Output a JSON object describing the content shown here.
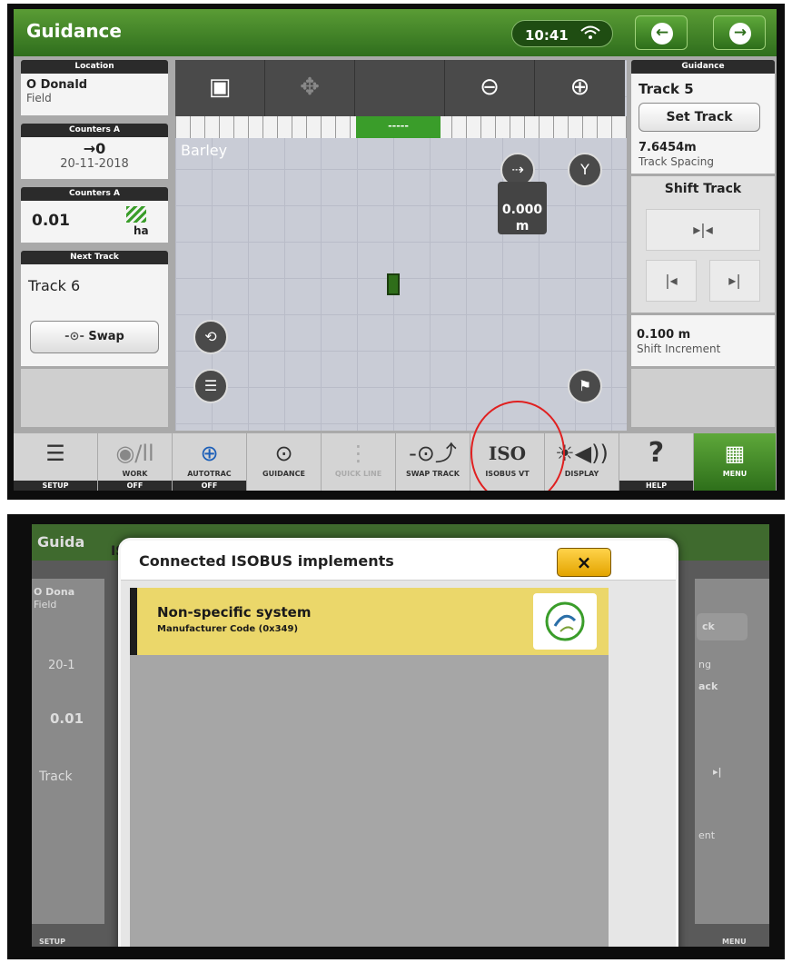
{
  "screen1": {
    "title": "Guidance",
    "clock": "10:41",
    "left_panel": {
      "location_header": "Location",
      "location_name": "O Donald",
      "location_sub": "Field",
      "counters_a_header_1": "Counters A",
      "counter_value": "→0",
      "counter_date": "20-11-2018",
      "counters_a_header_2": "Counters A",
      "area_value": "0.01",
      "area_unit": "ha",
      "next_track_header": "Next Track",
      "next_track_value": "Track 6",
      "swap_label": "Swap"
    },
    "map": {
      "crop_label": "Barley",
      "lightbar_center": "-----",
      "offset_value": "0.000",
      "offset_unit": "m"
    },
    "right_panel": {
      "header": "Guidance",
      "track_name": "Track 5",
      "set_track_label": "Set Track",
      "track_spacing_value": "7.6454m",
      "track_spacing_label": "Track Spacing",
      "shift_track_label": "Shift Track",
      "shift_increment_value": "0.100 m",
      "shift_increment_label": "Shift Increment"
    },
    "toolbar": {
      "setup": "SETUP",
      "work": "WORK",
      "work_state": "OFF",
      "autotrac": "AUTOTRAC",
      "autotrac_state": "OFF",
      "guidance": "GUIDANCE",
      "quick_line": "QUICK LINE",
      "swap_track": "SWAP TRACK",
      "isobus_vt": "ISOBUS VT",
      "iso_icon_text": "ISO",
      "display": "DISPLAY",
      "help": "HELP",
      "menu": "MENU"
    },
    "colors": {
      "accent_green": "#2f6e1d",
      "highlight_ring": "#e02020"
    }
  },
  "screen2": {
    "bg_title": "Guida",
    "bg_tab": "ISO",
    "bg_location": "O Dona",
    "bg_field": "Field",
    "bg_date": "20-1",
    "bg_area": "0.01",
    "bg_track": "Track",
    "bg_right_btn": "ck",
    "bg_right_ng": "ng",
    "bg_right_ack": "ack",
    "bg_right_ent": "ent",
    "bg_setup": "SETUP",
    "bg_menu": "MENU",
    "dialog": {
      "title": "Connected ISOBUS implements",
      "close_symbol": "×",
      "items": [
        {
          "name": "Non-specific system",
          "code": "Manufacturer Code (0x349)"
        }
      ]
    },
    "colors": {
      "item_highlight": "#ebd76a",
      "close_button": "#f0b820"
    }
  }
}
